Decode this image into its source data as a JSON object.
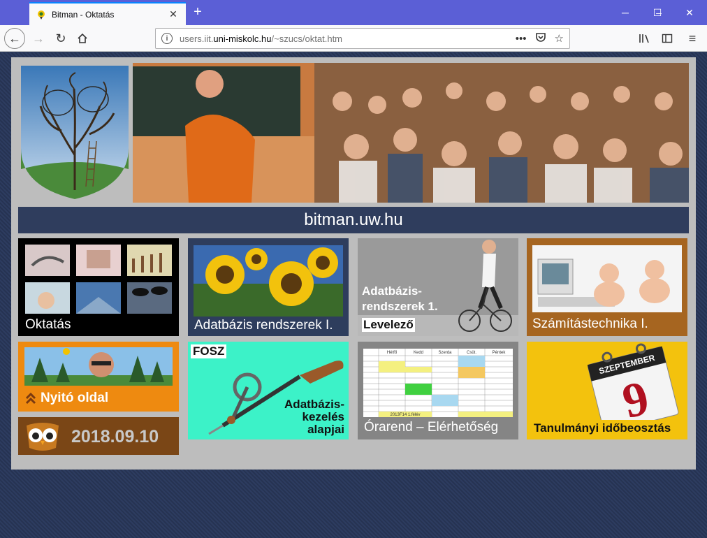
{
  "browser": {
    "tab_title": "Bitman - Oktatás",
    "url_prefix": "users.iit.",
    "url_domain": "uni-miskolc.hu",
    "url_suffix": "/~szucs/oktat.htm",
    "more_actions": "•••"
  },
  "site": {
    "title": "bitman.uw.hu"
  },
  "tiles": {
    "oktatas": "Oktatás",
    "adatbazis": "Adatbázis rendszerek I.",
    "levelezo_line1": "Adatbázis-",
    "levelezo_line2": "rendszerek 1.",
    "levelezo_badge": "Levelező",
    "szamtech": "Számítástechnika I.",
    "nyito": "Nyitó oldal",
    "date": "2018.09.10",
    "fosz_badge": "FOSZ",
    "fosz_line1": "Adatbázis-",
    "fosz_line2": "kezelés",
    "fosz_line3": "alapjai",
    "orarend": "Órarend – Elérhetőség",
    "tanulmanyi": "Tanulmányi időbeosztás",
    "calendar_month": "SZEPTEMBER",
    "calendar_day": "9"
  },
  "timetable": {
    "headers": [
      "Hétfő",
      "Kedd",
      "Szerda",
      "Csüt.",
      "Péntek"
    ],
    "footer": "2013F14 1.félév"
  },
  "colors": {
    "titlebar": "#5b5fd6",
    "site_bar": "#2f3d5d",
    "oktatas": "#000000",
    "nyito": "#ee8a10",
    "date": "#7a4616",
    "fosz": "#3cf2c8",
    "tanulmanyi": "#f3c20d"
  }
}
